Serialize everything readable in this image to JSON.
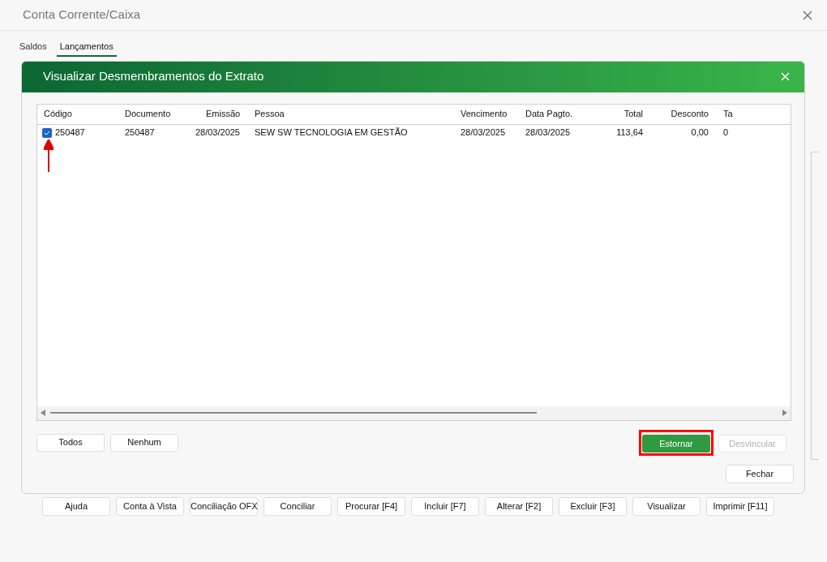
{
  "window": {
    "title": "Conta Corrente/Caixa"
  },
  "tabs": [
    {
      "label": "Saldos",
      "selected": false
    },
    {
      "label": "Lançamentos",
      "selected": true
    }
  ],
  "dialog": {
    "title": "Visualizar Desmembramentos do Extrato",
    "table": {
      "columns": [
        {
          "label": "Código"
        },
        {
          "label": "Documento"
        },
        {
          "label": "Emissão"
        },
        {
          "label": "Pessoa"
        },
        {
          "label": "Vencimento"
        },
        {
          "label": "Data Pagto."
        },
        {
          "label": "Total"
        },
        {
          "label": "Desconto"
        },
        {
          "label": "Ta"
        }
      ],
      "rows": [
        {
          "checked": true,
          "cells": [
            "250487",
            "250487",
            "28/03/2025",
            "SEW SW TECNOLOGIA EM GESTÃO",
            "28/03/2025",
            "28/03/2025",
            "113,64",
            "0,00",
            "0"
          ]
        }
      ]
    },
    "left_buttons": [
      {
        "label": "Todos"
      },
      {
        "label": "Nenhum"
      }
    ],
    "right_buttons": [
      {
        "label": "Estornar",
        "kind": "primary",
        "disabled": false,
        "highlighted": true
      },
      {
        "label": "Desvincular",
        "kind": "normal",
        "disabled": true,
        "highlighted": false
      }
    ],
    "close_button": "Fechar"
  },
  "toolbar": [
    {
      "label": "Ajuda"
    },
    {
      "label": "Conta à Vista"
    },
    {
      "label": "Conciliação OFX"
    },
    {
      "label": "Conciliar"
    },
    {
      "label": "Procurar [F4]"
    },
    {
      "label": "Incluir [F7]"
    },
    {
      "label": "Alterar [F2]"
    },
    {
      "label": "Excluir [F3]"
    },
    {
      "label": "Visualizar"
    },
    {
      "label": "Imprimir [F11]"
    }
  ]
}
